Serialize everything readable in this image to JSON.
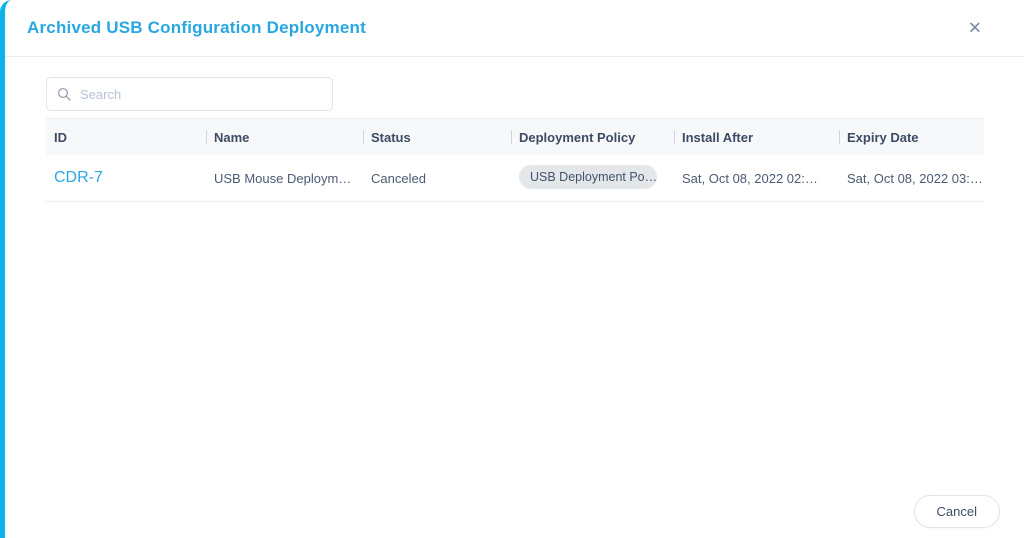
{
  "modal": {
    "title": "Archived USB Configuration Deployment",
    "close_glyph": "✕"
  },
  "search": {
    "placeholder": "Search"
  },
  "table": {
    "columns": [
      "ID",
      "Name",
      "Status",
      "Deployment Policy",
      "Install After",
      "Expiry Date"
    ],
    "rows": [
      {
        "id": "CDR-7",
        "name": "USB Mouse Deploym…",
        "status": "Canceled",
        "policy": "USB Deployment Po…",
        "install_after": "Sat, Oct 08, 2022 02:…",
        "expiry": "Sat, Oct 08, 2022 03:…"
      }
    ]
  },
  "footer": {
    "cancel_label": "Cancel"
  },
  "colors": {
    "accent_blue": "#29a7e1",
    "left_border_cyan": "#0db3e8",
    "header_text": "#3d4b64",
    "body_text": "#4b5a72",
    "chip_background": "#e3e7ea",
    "header_row_background": "#f6f8fa",
    "divider": "#e9edf3"
  }
}
